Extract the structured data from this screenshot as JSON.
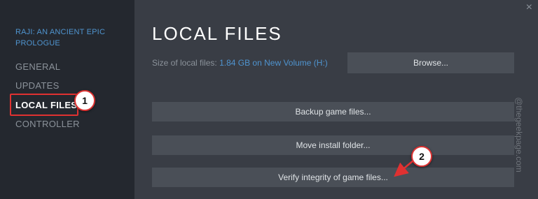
{
  "sidebar": {
    "game_title": "RAJI: AN ANCIENT EPIC PROLOGUE",
    "items": [
      {
        "label": "GENERAL"
      },
      {
        "label": "UPDATES"
      },
      {
        "label": "LOCAL FILES"
      },
      {
        "label": "CONTROLLER"
      }
    ],
    "active_index": 2
  },
  "main": {
    "title": "LOCAL FILES",
    "size_label": "Size of local files:",
    "size_value": "1.84 GB on New Volume (H:)",
    "browse_button": "Browse...",
    "buttons": [
      {
        "label": "Backup game files..."
      },
      {
        "label": "Move install folder..."
      },
      {
        "label": "Verify integrity of game files..."
      }
    ]
  },
  "window": {
    "close_icon": "×"
  },
  "annotations": {
    "step1": "1",
    "step2": "2",
    "highlight_color": "#e03131"
  },
  "watermark": "@thegeekpage.com",
  "colors": {
    "sidebar_bg": "#24282f",
    "main_bg": "#393d45",
    "accent_blue": "#4f94cf",
    "button_bg": "#4a4f57"
  }
}
